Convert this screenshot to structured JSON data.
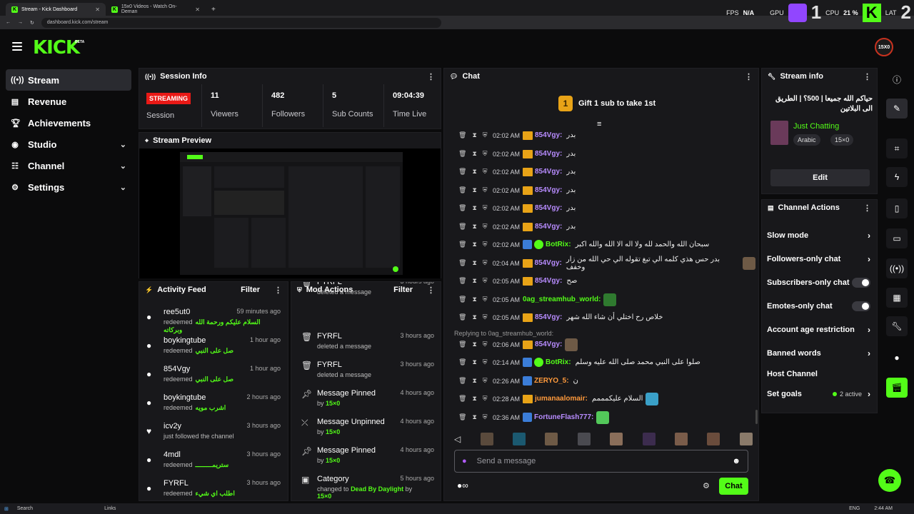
{
  "browser": {
    "tabs": [
      {
        "title": "Stream - Kick Dashboard",
        "active": true
      },
      {
        "title": "15x0 Videos - Watch On-Deman",
        "active": false
      }
    ],
    "url": "dashboard.kick.com/stream"
  },
  "overlay": {
    "fps_label": "FPS",
    "fps_value": "N/A",
    "gpu_label": "GPU",
    "cpu_label": "CPU",
    "cpu_value": "21 %",
    "lat_label": "LAT",
    "num1": "1",
    "num2": "2"
  },
  "header": {
    "logo": "KICK",
    "beta": "BETA",
    "avatar_text": "15X0"
  },
  "sidebar": {
    "items": [
      {
        "label": "Stream",
        "icon": "broadcast-icon"
      },
      {
        "label": "Revenue",
        "icon": "chart-icon"
      },
      {
        "label": "Achievements",
        "icon": "trophy-icon"
      },
      {
        "label": "Studio",
        "icon": "camera-icon"
      },
      {
        "label": "Channel",
        "icon": "people-icon"
      },
      {
        "label": "Settings",
        "icon": "gear-icon"
      }
    ]
  },
  "session": {
    "title": "Session Info",
    "badge": "STREAMING",
    "session_label": "Session",
    "stats": [
      {
        "value": "11",
        "label": "Viewers"
      },
      {
        "value": "482",
        "label": "Followers"
      },
      {
        "value": "5",
        "label": "Sub Counts"
      },
      {
        "value": "09:04:39",
        "label": "Time Live"
      }
    ]
  },
  "preview": {
    "title": "Stream Preview"
  },
  "activity": {
    "title": "Activity Feed",
    "filter": "Filter",
    "items": [
      {
        "user": "ree5ut0",
        "time": "59 minutes ago",
        "action": "redeemed",
        "reward": "السلام عليكم ورحمة الله وبركاته"
      },
      {
        "user": "boykingtube",
        "time": "1 hour ago",
        "action": "redeemed",
        "reward": "صل على النبي"
      },
      {
        "user": "854Vgy",
        "time": "1 hour ago",
        "action": "redeemed",
        "reward": "صل على النبي"
      },
      {
        "user": "boykingtube",
        "time": "2 hours ago",
        "action": "redeemed",
        "reward": "اشرب مويه"
      },
      {
        "user": "icv2y",
        "time": "3 hours ago",
        "action": "just followed the channel",
        "reward": ""
      },
      {
        "user": "4mdl",
        "time": "3 hours ago",
        "action": "redeemed",
        "reward": "ستريمـــــــــ"
      },
      {
        "user": "FYRFL",
        "time": "3 hours ago",
        "action": "redeemed",
        "reward": "اطلب اي شيء"
      }
    ]
  },
  "mod": {
    "title": "Mod Actions",
    "filter": "Filter",
    "items": [
      {
        "title": "FYRFL",
        "sub": "deleted a message",
        "sub_hl": "",
        "time": "3 hours ago",
        "icon": "trash-icon"
      },
      {
        "title": "FYRFL",
        "sub": "deleted a message",
        "sub_hl": "",
        "time": "3 hours ago",
        "icon": "trash-icon"
      },
      {
        "title": "FYRFL",
        "sub": "deleted a message",
        "sub_hl": "",
        "time": "3 hours ago",
        "icon": "trash-icon"
      },
      {
        "title": "Message Pinned",
        "sub": "by",
        "sub_hl": "15×0",
        "time": "4 hours ago",
        "icon": "pin-icon"
      },
      {
        "title": "Message Unpinned",
        "sub": "by",
        "sub_hl": "15×0",
        "time": "4 hours ago",
        "icon": "unpin-icon"
      },
      {
        "title": "Message Pinned",
        "sub": "by",
        "sub_hl": "15×0",
        "time": "4 hours ago",
        "icon": "pin-icon"
      },
      {
        "title": "Category",
        "sub": "changed to",
        "sub_hl": "Dead By Daylight",
        "sub2": "by",
        "sub3": "15×0",
        "time": "5 hours ago",
        "icon": "category-icon"
      }
    ]
  },
  "chat": {
    "title": "Chat",
    "gift_text": "Gift 1 sub to take 1st",
    "gift_num": "1",
    "reply_text": "Replying to 0ag_streamhub_world:",
    "messages": [
      {
        "time": "02:02 AM",
        "badge": "crown",
        "user": "854Vgy:",
        "color": "#b88cff",
        "text": "بدر"
      },
      {
        "time": "02:02 AM",
        "badge": "crown",
        "user": "854Vgy:",
        "color": "#b88cff",
        "text": "بدر"
      },
      {
        "time": "02:02 AM",
        "badge": "crown",
        "user": "854Vgy:",
        "color": "#b88cff",
        "text": "بدر"
      },
      {
        "time": "02:02 AM",
        "badge": "crown",
        "user": "854Vgy:",
        "color": "#b88cff",
        "text": "بدر"
      },
      {
        "time": "02:02 AM",
        "badge": "crown",
        "user": "854Vgy:",
        "color": "#b88cff",
        "text": "بدر"
      },
      {
        "time": "02:02 AM",
        "badge": "crown",
        "user": "854Vgy:",
        "color": "#b88cff",
        "text": "بدر"
      },
      {
        "time": "02:02 AM",
        "badge": "bot",
        "user": "BotRix:",
        "color": "#53fc18",
        "text": "سبحان الله والحمد لله ولا اله الا الله والله اكبر"
      },
      {
        "time": "02:04 AM",
        "badge": "crown",
        "user": "854Vgy:",
        "color": "#b88cff",
        "text": "بدر حس هذي كلمه الي تبغ تقوله الي حي الله من زار وخفف"
      },
      {
        "time": "02:05 AM",
        "badge": "crown",
        "user": "854Vgy:",
        "color": "#b88cff",
        "text": "صح"
      },
      {
        "time": "02:05 AM",
        "badge": "",
        "user": "0ag_streamhub_world:",
        "color": "#53fc18",
        "text": ""
      },
      {
        "time": "02:05 AM",
        "badge": "crown",
        "user": "854Vgy:",
        "color": "#b88cff",
        "text": "خلاص رح اختلي أن شاء الله شهر"
      },
      {
        "time": "02:06 AM",
        "badge": "crown",
        "user": "854Vgy:",
        "color": "#b88cff",
        "text": ""
      },
      {
        "time": "02:14 AM",
        "badge": "bot",
        "user": "BotRix:",
        "color": "#53fc18",
        "text": "صلوا على النبي محمد صلى الله عليه وسلم"
      },
      {
        "time": "02:26 AM",
        "badge": "bot2",
        "user": "ZERYO_5:",
        "color": "#ff9a3c",
        "text": "ن"
      },
      {
        "time": "02:28 AM",
        "badge": "crown",
        "user": "jumanaalomair:",
        "color": "#ff9a3c",
        "text": "السلام عليكمممم"
      },
      {
        "time": "02:36 AM",
        "badge": "bot2",
        "user": "FortuneFlash777:",
        "color": "#b88cff",
        "text": ""
      }
    ],
    "placeholder": "Send a message",
    "send": "Chat"
  },
  "streaminfo": {
    "title": "Stream info",
    "stream_title": "حياكم الله جميعا | 500؟ | الطريق الى البلاتين",
    "category": "Just Chatting",
    "tags": [
      "Arabic",
      "15×0"
    ],
    "edit": "Edit"
  },
  "actions": {
    "title": "Channel Actions",
    "rows": [
      {
        "label": "Slow mode",
        "kind": "chevron"
      },
      {
        "label": "Followers-only chat",
        "kind": "chevron"
      },
      {
        "label": "Subscribers-only chat",
        "kind": "toggle"
      },
      {
        "label": "Emotes-only chat",
        "kind": "toggle"
      },
      {
        "label": "Account age restriction",
        "kind": "chevron"
      },
      {
        "label": "Banned words",
        "kind": "chevron"
      },
      {
        "label": "Host Channel",
        "kind": "none"
      },
      {
        "label": "Set goals",
        "kind": "chevron",
        "extra": "2 active"
      }
    ]
  },
  "taskbar": {
    "search": "Search",
    "links": "Links",
    "lang": "ENG",
    "time": "2:44 AM"
  }
}
